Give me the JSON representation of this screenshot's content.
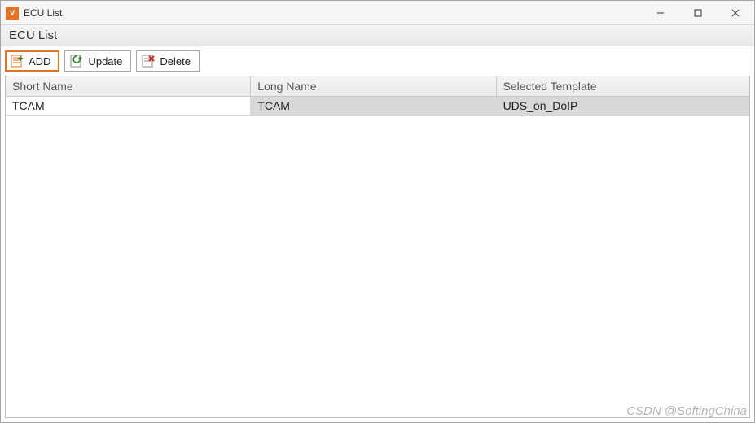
{
  "window": {
    "title": "ECU List",
    "icon_label": "V"
  },
  "subheader": {
    "label": "ECU List"
  },
  "toolbar": {
    "add_label": "ADD",
    "update_label": "Update",
    "delete_label": "Delete"
  },
  "grid": {
    "headers": {
      "short_name": "Short Name",
      "long_name": "Long Name",
      "selected_template": "Selected Template"
    },
    "rows": [
      {
        "short_name": "TCAM",
        "long_name": "TCAM",
        "selected_template": "UDS_on_DoIP"
      }
    ]
  },
  "watermark": "CSDN @SoftingChina"
}
